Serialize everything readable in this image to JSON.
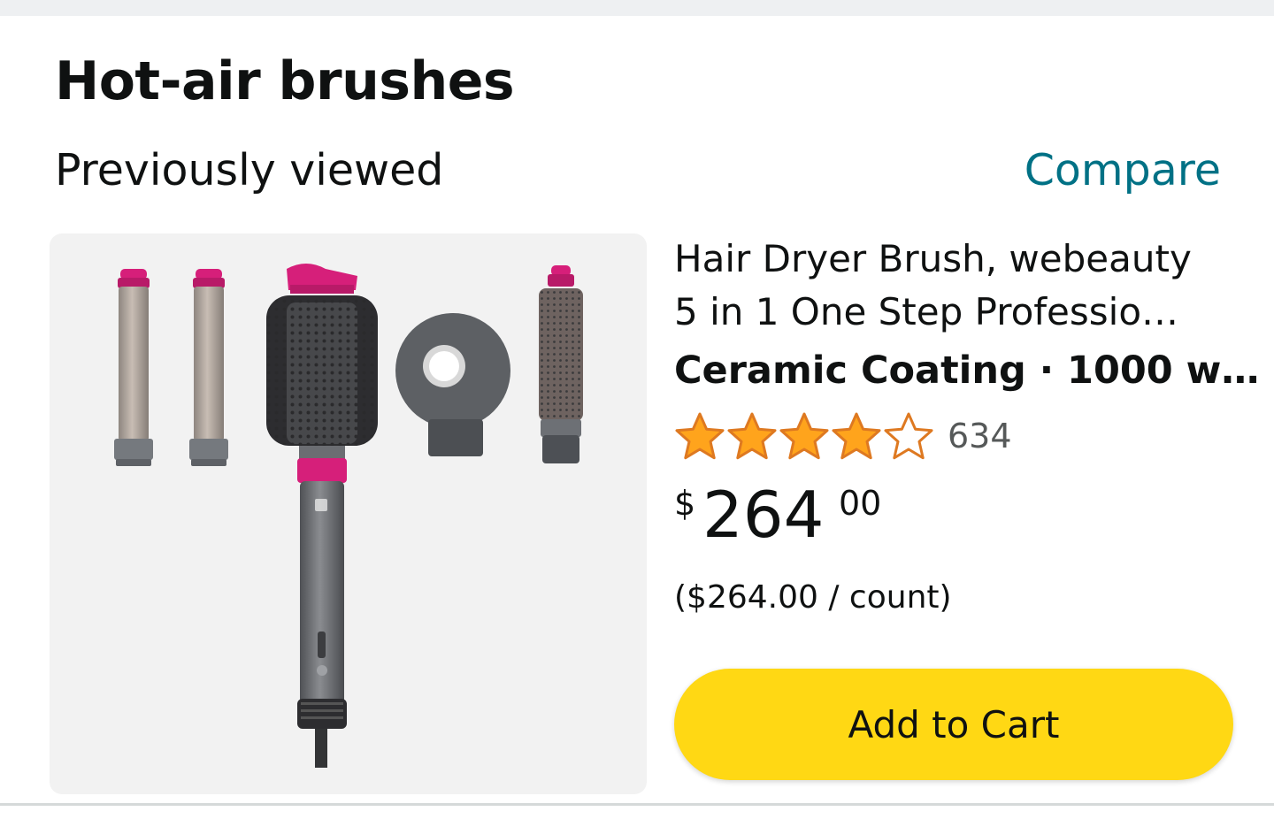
{
  "section": {
    "title": "Hot-air brushes",
    "subtitle": "Previously viewed",
    "compare_label": "Compare"
  },
  "product": {
    "image_icon": "hot-air-brush-set-image",
    "title_line1": "Hair Dryer Brush, webeauty",
    "title_line2": "5 in 1 One Step Professio…",
    "attributes": "Ceramic Coating · 1000 w…",
    "rating": {
      "stars": 4,
      "max_stars": 5,
      "count": "634"
    },
    "price": {
      "symbol": "$",
      "whole": "264",
      "fraction": "00"
    },
    "unit_price": "($264.00 / count)"
  },
  "actions": {
    "add_to_cart": "Add to Cart"
  },
  "colors": {
    "link": "#007185",
    "star": "#ffa41c",
    "star_outline": "#de7921",
    "button": "#ffd814",
    "accent_pink": "#d61f7a"
  }
}
